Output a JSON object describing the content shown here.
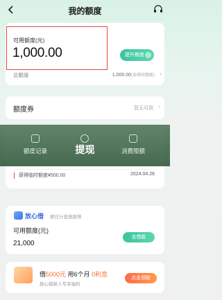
{
  "header": {
    "title": "我的额度",
    "back_icon": "back-icon",
    "service_icon": "headset-icon"
  },
  "quota": {
    "label": "可用额度(元)",
    "value": "1,000.00",
    "raise_button": "提升额度",
    "total_label": "总额度",
    "total_value": "1,000.00",
    "total_note": "(含临时额度)"
  },
  "coupon": {
    "title": "额度券",
    "status": "暂无可用"
  },
  "menu": {
    "items": [
      {
        "label": "额度记录",
        "icon": "record-icon"
      },
      {
        "label": "提现",
        "icon": "info-icon"
      },
      {
        "label": "消费限额",
        "icon": "lock-icon"
      }
    ],
    "toast": "提现"
  },
  "record": {
    "text": "获得临时额度¥500.00",
    "date": "2024.04.26"
  },
  "loan": {
    "brand": "放心借",
    "slogan": "按日计息放款快",
    "label": "可用额度(元)",
    "value": "21,000",
    "button": "去借款"
  },
  "promo": {
    "line1_prefix": "借",
    "amount": "5000元",
    "line1_mid": " 用6个月 ",
    "interest": "0利息",
    "line2": "放心借新人专享福利",
    "button": "点击领取"
  },
  "colors": {
    "accent_green": "#3bc59f",
    "highlight_red": "#e04a3a",
    "promo_orange": "#ff6a2a"
  }
}
